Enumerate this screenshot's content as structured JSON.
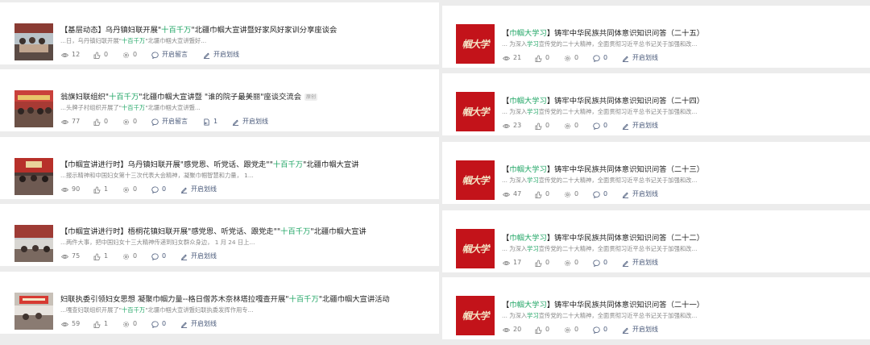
{
  "articles_left": [
    {
      "title_pre": "【基层动态】乌丹镇妇联开展\"",
      "title_hl": "十百千万",
      "title_post": "\"北疆巾帼大宣讲暨好家风好家训分享座谈会",
      "tag": "",
      "summary_pre": "...日，乌丹镇妇联开展\"",
      "summary_hl": "十百千万",
      "summary_post": "\"北疆巾帼大宣讲暨好...",
      "views": "12",
      "likes": "0",
      "shares": "0",
      "comment_label": "开启留言",
      "reply_count": "",
      "underline_label": "开启划线"
    },
    {
      "title_pre": "翁旗妇联组织\"",
      "title_hl": "十百千万",
      "title_post": "\"北疆巾帼大宣讲暨 \"谁的院子最美丽\"座谈交流会",
      "tag": "原创",
      "summary_pre": "...头牌子村组织开展了\"",
      "summary_hl": "十百千万",
      "summary_post": "\"北疆巾帼大宣讲暨...",
      "views": "77",
      "likes": "0",
      "shares": "0",
      "comment_label": "开启留言",
      "reply_count": "1",
      "underline_label": "开启划线"
    },
    {
      "title_pre": "【巾帼宣讲进行时】乌丹镇妇联开展\"感党恩、听党话、跟党走\"\"",
      "title_hl": "十百千万",
      "title_post": "\"北疆巾帼大宣讲",
      "tag": "",
      "summary_pre": "...报示精神和中国妇女第十三次代表大会精神，凝聚巾帼智慧和力量， 1...",
      "summary_hl": "",
      "summary_post": "",
      "views": "90",
      "likes": "1",
      "shares": "0",
      "comment_label": "0",
      "reply_count": "",
      "underline_label": "开启划线"
    },
    {
      "title_pre": "【巾帼宣讲进行时】梧桐花镇妇联开展\"感党恩、听党话、跟党走\"\"",
      "title_hl": "十百千万",
      "title_post": "\"北疆巾帼大宣讲",
      "tag": "",
      "summary_pre": "...两件大事，把中国妇女十三大精神传递到妇女群众身边， 1 月 24 日上...",
      "summary_hl": "",
      "summary_post": "",
      "views": "75",
      "likes": "1",
      "shares": "0",
      "comment_label": "0",
      "reply_count": "",
      "underline_label": "开启划线"
    },
    {
      "title_pre": "妇联执委引领妇女思想 凝聚巾帼力量--格日僧苏木奈林塔拉嘎查开展\"",
      "title_hl": "十百千万",
      "title_post": "\"北疆巾帼大宣讲活动",
      "tag": "",
      "summary_pre": "...嘎查妇联组织开展了\"",
      "summary_hl": "十百千万",
      "summary_post": "\"北疆巾帼大宣讲暨妇联执委发挥作用专...",
      "views": "59",
      "likes": "1",
      "shares": "0",
      "comment_label": "0",
      "reply_count": "",
      "underline_label": "开启划线"
    }
  ],
  "articles_right": [
    {
      "title_pre": "【",
      "title_hl": "巾帼大学习",
      "title_post": "】铸牢中华民族共同体意识知识问答（二十五）",
      "summary_pre": "... 为深入",
      "summary_hl": "学习",
      "summary_post": "宣传党的二十大精神，全面贯彻习近平总书记关于加强和改...",
      "views": "21",
      "likes": "0",
      "shares": "0",
      "comments": "0",
      "underline_label": "开启划线"
    },
    {
      "title_pre": "【",
      "title_hl": "巾帼大学习",
      "title_post": "】铸牢中华民族共同体意识知识问答（二十四）",
      "summary_pre": "... 为深入",
      "summary_hl": "学习",
      "summary_post": "宣传党的二十大精神，全面贯彻习近平总书记关于加强和改...",
      "views": "23",
      "likes": "0",
      "shares": "0",
      "comments": "0",
      "underline_label": "开启划线"
    },
    {
      "title_pre": "【",
      "title_hl": "巾帼大学习",
      "title_post": "】铸牢中华民族共同体意识知识问答（二十三）",
      "summary_pre": "... 为深入",
      "summary_hl": "学习",
      "summary_post": "宣传党的二十大精神，全面贯彻习近平总书记关于加强和改...",
      "views": "47",
      "likes": "0",
      "shares": "0",
      "comments": "0",
      "underline_label": "开启划线"
    },
    {
      "title_pre": "【",
      "title_hl": "巾帼大学习",
      "title_post": "】铸牢中华民族共同体意识知识问答（二十二）",
      "summary_pre": "... 为深入",
      "summary_hl": "学习",
      "summary_post": "宣传党的二十大精神，全面贯彻习近平总书记关于加强和改...",
      "views": "17",
      "likes": "0",
      "shares": "0",
      "comments": "0",
      "underline_label": "开启划线"
    },
    {
      "title_pre": "【",
      "title_hl": "巾帼大学习",
      "title_post": "】铸牢中华民族共同体意识知识问答（二十一）",
      "summary_pre": "... 为深入",
      "summary_hl": "学习",
      "summary_post": "宣传党的二十大精神，全面贯彻习近平总书记关于加强和改...",
      "views": "20",
      "likes": "0",
      "shares": "0",
      "comments": "0",
      "underline_label": "开启划线"
    }
  ],
  "seal_text": "帼大学",
  "icons": {
    "views": "eye-icon",
    "likes": "thumbs-up-icon",
    "shares": "share-gear-icon",
    "comments": "speech-bubble-icon",
    "reply": "reply-doc-icon",
    "underline": "pen-underline-icon"
  },
  "colors": {
    "highlight": "#1fa564",
    "seal_red": "#c3131a",
    "meta_link": "#4a5a7a"
  }
}
